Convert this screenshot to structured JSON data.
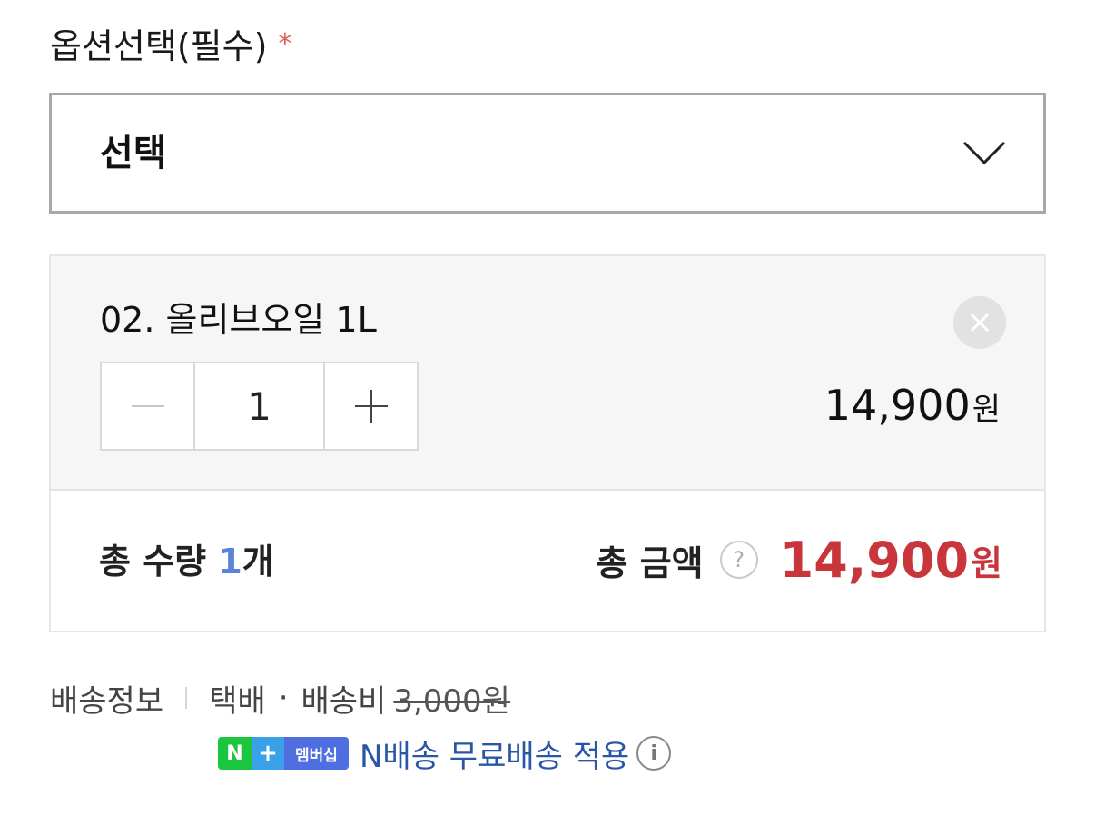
{
  "option": {
    "label": "옵션선택(필수)",
    "required_mark": "*",
    "select_value": "선택"
  },
  "item": {
    "name": "02. 올리브오일 1L",
    "quantity": "1",
    "price": "14,900",
    "currency": "원"
  },
  "total": {
    "qty_label": "총 수량 ",
    "qty_value": "1",
    "qty_unit": "개",
    "amount_label": "총 금액",
    "help_symbol": "?",
    "amount": "14,900",
    "currency": "원"
  },
  "delivery": {
    "label": "배송정보",
    "method": "택배",
    "dot": "·",
    "fee_label": "배송비",
    "fee_original": "3,000원",
    "nplus_n": "N",
    "nplus_plus": "+",
    "nplus_member": "멤버십",
    "nplus_text": "N배송 무료배송 적용",
    "info_symbol": "i"
  },
  "colors": {
    "required": "#e0605a",
    "total_price": "#c8363c",
    "qty_accent": "#5b84d6",
    "nplus_link": "#2957a6"
  },
  "icons": {
    "dropdown": "chevron-down-icon",
    "remove": "close-icon",
    "decrement": "minus-icon",
    "increment": "plus-icon",
    "help": "question-icon",
    "info": "info-icon"
  }
}
